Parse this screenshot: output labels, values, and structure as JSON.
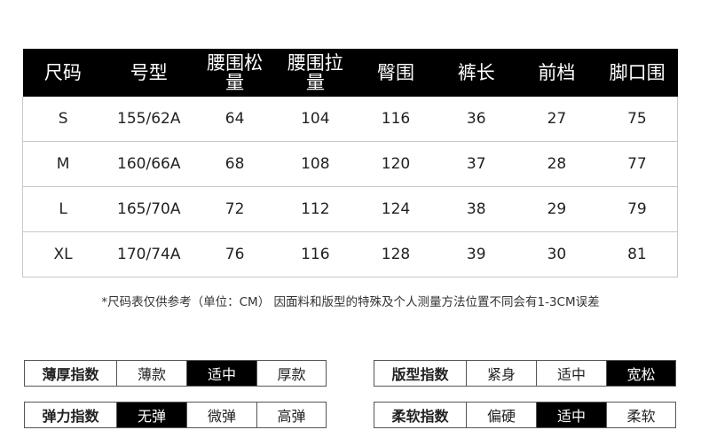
{
  "table": {
    "headers": [
      "尺码",
      "号型",
      "腰围松\n量",
      "腰围拉\n量",
      "臀围",
      "裤长",
      "前档",
      "脚口围"
    ],
    "rows": [
      [
        "S",
        "155/62A",
        "64",
        "104",
        "116",
        "36",
        "27",
        "75"
      ],
      [
        "M",
        "160/66A",
        "68",
        "108",
        "120",
        "37",
        "28",
        "77"
      ],
      [
        "L",
        "165/70A",
        "72",
        "112",
        "124",
        "38",
        "29",
        "79"
      ],
      [
        "XL",
        "170/74A",
        "76",
        "116",
        "128",
        "39",
        "30",
        "81"
      ]
    ]
  },
  "note": "*尺码表仅供参考（单位：CM） 因面料和版型的特殊及个人测量方法位置不同会有1-3CM误差",
  "indices": [
    {
      "label": "薄厚指数",
      "options": [
        "薄款",
        "适中",
        "厚款"
      ],
      "selected": "适中"
    },
    {
      "label": "版型指数",
      "options": [
        "紧身",
        "适中",
        "宽松"
      ],
      "selected": "宽松"
    },
    {
      "label": "弹力指数",
      "options": [
        "无弹",
        "微弹",
        "高弹"
      ],
      "selected": "无弹"
    },
    {
      "label": "柔软指数",
      "options": [
        "偏硬",
        "适中",
        "柔软"
      ],
      "selected": "适中"
    }
  ]
}
